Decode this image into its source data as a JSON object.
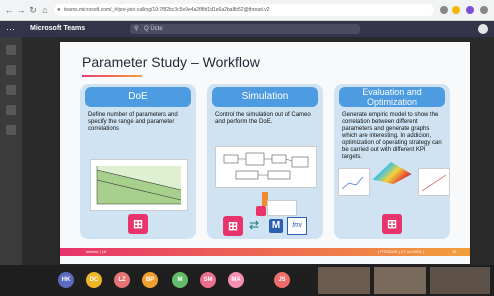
{
  "browser": {
    "url": "teams.microsoft.com/_#/pre-join-calling/19:7f82bc3c5e9e4a2f8fd1d1e6a2ba8b52@thread.v2"
  },
  "teams": {
    "app_title": "Microsoft Teams",
    "search_placeholder": "Q Ücte"
  },
  "slide": {
    "title": "Parameter Study  –  Workflow",
    "columns": [
      {
        "heading": "DoE",
        "text": "Define number of parameters and specify the range and parameter correlations"
      },
      {
        "heading": "Simulation",
        "text": "Control the simulation out of Cameo and perform the DoE."
      },
      {
        "heading": "Evaluation and Optimization",
        "text": "Generate empiric model to show the correlation between different parameters and generate graphs which are interesting. In addicion, optimization of operating strategy can be carried out with different KPI targets."
      }
    ],
    "fmi_label": "fmi",
    "m_label": "M",
    "footer_left": "Interne  |  16",
    "footer_right": "| PTE/DOE |  07 Jul 2021 |",
    "page_num": "16"
  },
  "participants": [
    {
      "initials": "HK",
      "color": "#5c6bc0"
    },
    {
      "initials": "DC",
      "color": "#f0b429"
    },
    {
      "initials": "LZ",
      "color": "#e57373"
    },
    {
      "initials": "BP",
      "color": "#f0a030"
    },
    {
      "initials": "M",
      "color": "#66bb6a"
    },
    {
      "initials": "SM",
      "color": "#ec6d8c"
    },
    {
      "initials": "MA",
      "color": "#f48fb1"
    },
    {
      "initials": "JS",
      "color": "#ef6c6c"
    }
  ],
  "colors": {
    "accent_pink": "#e8336b",
    "header_blue": "#4d9be0",
    "panel_blue": "#cfe3f2",
    "teams_purple": "#33344a"
  }
}
